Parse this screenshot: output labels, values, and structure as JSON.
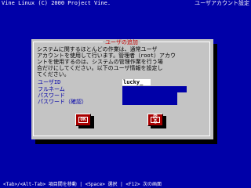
{
  "titlebar": {
    "left": "Vine Linux (C) 2000 Project Vine.",
    "right": "ユーザアカウント設定"
  },
  "dialog": {
    "title": "ユーザの追加",
    "description": "システムに関するほとんどの作業は、通常ユーザ\nアカウントを使用して行います。管理者（root）アカウ\nントを使用するのは、システムの管理作業を行う場\n合だけにしてください。以下のユーザ情報を設定し\nてください。",
    "fields": [
      {
        "label": "ユーザID",
        "value": "lucky_"
      },
      {
        "label": "フルネーム",
        "value": ""
      },
      {
        "label": "パスワード",
        "value": ""
      },
      {
        "label": "パスワード（確認）",
        "value": ""
      }
    ],
    "ok_label": "OK",
    "back_label": "戻る"
  },
  "statusbar": {
    "text": "<Tab>/<Alt-Tab> 項目間を移動 | <Space> 選択 | <F12> 次の画面"
  },
  "colors": {
    "background": "#0000a8",
    "dialog": "#c4c4c4",
    "button": "#a80000",
    "title_accent": "#c40000"
  }
}
